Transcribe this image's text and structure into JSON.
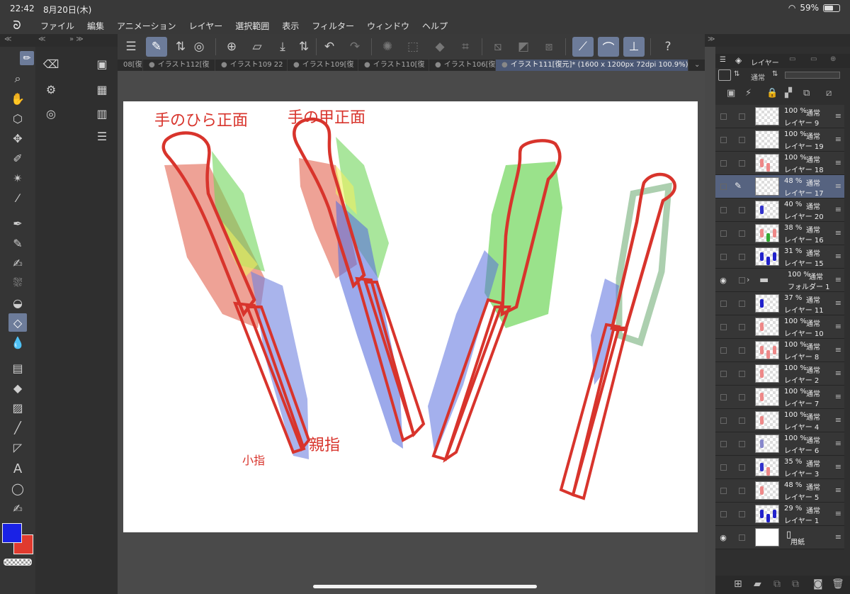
{
  "status": {
    "time": "22:42",
    "date": "8月20日(木)",
    "battery": "59%"
  },
  "menu": [
    "ファイル",
    "編集",
    "アニメーション",
    "レイヤー",
    "選択範囲",
    "表示",
    "フィルター",
    "ウィンドウ",
    "ヘルプ"
  ],
  "tabs": [
    "08[復",
    "イラスト112[復",
    "イラスト109 22",
    "イラスト109[復",
    "イラスト110[復",
    "イラスト106[復",
    "イラスト111[復元]* (1600 x 1200px 72dpi 100.9%)"
  ],
  "layer_panel": {
    "tab_label": "レイヤー",
    "blend_mode": "通常"
  },
  "layers": [
    {
      "opacity": "100 %",
      "mode": "通常",
      "name": "レイヤー 9"
    },
    {
      "opacity": "100 %",
      "mode": "通常",
      "name": "レイヤー 19"
    },
    {
      "opacity": "100 %",
      "mode": "通常",
      "name": "レイヤー 18"
    },
    {
      "opacity": "48 %",
      "mode": "通常",
      "name": "レイヤー 17",
      "selected": true
    },
    {
      "opacity": "40 %",
      "mode": "通常",
      "name": "レイヤー 20"
    },
    {
      "opacity": "38 %",
      "mode": "通常",
      "name": "レイヤー 16"
    },
    {
      "opacity": "31 %",
      "mode": "通常",
      "name": "レイヤー 15"
    },
    {
      "opacity": "100 %",
      "mode": "通常",
      "name": "フォルダー 1",
      "folder": true,
      "visible": true
    },
    {
      "opacity": "37 %",
      "mode": "通常",
      "name": "レイヤー 11"
    },
    {
      "opacity": "100 %",
      "mode": "通常",
      "name": "レイヤー 10"
    },
    {
      "opacity": "100 %",
      "mode": "通常",
      "name": "レイヤー 8"
    },
    {
      "opacity": "100 %",
      "mode": "通常",
      "name": "レイヤー 2"
    },
    {
      "opacity": "100 %",
      "mode": "通常",
      "name": "レイヤー 7"
    },
    {
      "opacity": "100 %",
      "mode": "通常",
      "name": "レイヤー 4"
    },
    {
      "opacity": "100 %",
      "mode": "通常",
      "name": "レイヤー 6"
    },
    {
      "opacity": "35 %",
      "mode": "通常",
      "name": "レイヤー 3"
    },
    {
      "opacity": "48 %",
      "mode": "通常",
      "name": "レイヤー 5"
    },
    {
      "opacity": "29 %",
      "mode": "通常",
      "name": "レイヤー 1"
    },
    {
      "name": "用紙",
      "paper": true,
      "visible": true
    }
  ],
  "canvas": {
    "label_palm": "手のひら正面",
    "label_back": "手の甲正面",
    "label_pinky": "小指",
    "label_thumb": "親指"
  },
  "colors": {
    "main": "#1a22e6",
    "sub": "#e03a2e",
    "accent": "#6d7c9a"
  }
}
